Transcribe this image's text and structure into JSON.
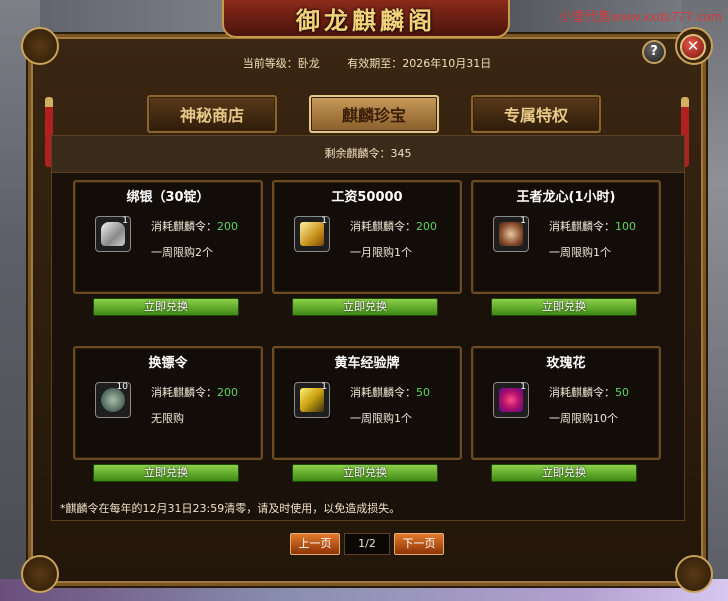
{
  "watermark": "小雪代售www.xxds777.com",
  "window": {
    "title": "御龙麒麟阁",
    "help_label": "?",
    "close_label": "✕"
  },
  "header": {
    "level": "当前等级：卧龙",
    "expiry": "有效期至：2026年10月31日"
  },
  "tabs": [
    {
      "label": "神秘商店",
      "active": false
    },
    {
      "label": "麒麟珍宝",
      "active": true
    },
    {
      "label": "专属特权",
      "active": false
    }
  ],
  "remaining": "剩余麒麟令：345",
  "cost_prefix": "消耗麒麟令：",
  "redeem_label": "立即兑换",
  "items": [
    {
      "title": "绑银（30锭）",
      "icon": "silver-ingot-icon",
      "count": "1",
      "cost": "200",
      "limit": "一周限购2个"
    },
    {
      "title": "工资50000",
      "icon": "gold-wage-icon",
      "count": "1",
      "cost": "200",
      "limit": "一月限购1个"
    },
    {
      "title": "王者龙心(1小时)",
      "icon": "dragon-heart-icon",
      "count": "1",
      "cost": "100",
      "limit": "一周限购1个"
    },
    {
      "title": "换镖令",
      "icon": "escort-token-icon",
      "count": "10",
      "cost": "200",
      "limit": "无限购"
    },
    {
      "title": "黄车经验牌",
      "icon": "exp-plaque-icon",
      "count": "1",
      "cost": "50",
      "limit": "一周限购1个"
    },
    {
      "title": "玫瑰花",
      "icon": "rose-icon",
      "count": "1",
      "cost": "50",
      "limit": "一周限购10个"
    }
  ],
  "notice": "*麒麟令在每年的12月31日23:59清零，请及时使用，以免造成损失。",
  "pager": {
    "prev": "上一页",
    "page": "1/2",
    "next": "下一页"
  },
  "colors": {
    "accent_gold": "#f3d27a",
    "cost_green": "#5fd45f",
    "redeem_green": "#6cb030",
    "pager_orange": "#d06020",
    "watermark_red": "#d23c3c"
  }
}
